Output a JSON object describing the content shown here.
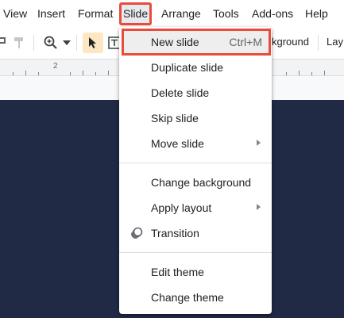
{
  "menubar": {
    "items": [
      "View",
      "Insert",
      "Format",
      "Slide",
      "Arrange",
      "Tools",
      "Add-ons",
      "Help"
    ],
    "active": "Slide"
  },
  "toolbar": {
    "zoom_icon": "zoom-icon",
    "cursor_icon": "select-cursor-icon",
    "textbox_icon": "textbox-icon",
    "background_button": "kground",
    "layout_button": "Lay"
  },
  "ruler": {
    "label": "2"
  },
  "slide_menu": {
    "items": [
      {
        "label": "New slide",
        "shortcut": "Ctrl+M",
        "highlighted": true
      },
      {
        "label": "Duplicate slide"
      },
      {
        "label": "Delete slide"
      },
      {
        "label": "Skip slide"
      },
      {
        "label": "Move slide",
        "submenu": true
      },
      {
        "label": "Change background"
      },
      {
        "label": "Apply layout",
        "submenu": true
      },
      {
        "label": "Transition",
        "icon": "transition-icon"
      },
      {
        "label": "Edit theme"
      },
      {
        "label": "Change theme"
      }
    ]
  },
  "colors": {
    "slide_background": "#202a44",
    "highlight_outline": "#e74c3c",
    "select_tool_bg": "#fde7c3"
  }
}
